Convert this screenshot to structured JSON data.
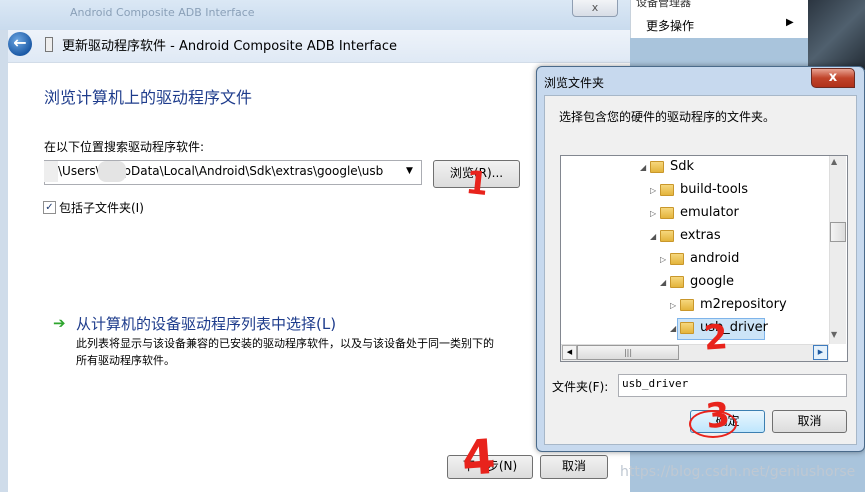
{
  "background": {
    "breadcrumb": "Android Composite ADB Interface",
    "close_label": "x",
    "right_panel_title": "设备管理器",
    "right_panel_item": "更多操作",
    "right_panel_arrow": "▶"
  },
  "wizard": {
    "title": "更新驱动程序软件 - Android Composite ADB Interface",
    "heading": "浏览计算机上的驱动程序文件",
    "search_label": "在以下位置搜索驱动程序软件:",
    "path_value": "\\Users\\      \\AppData\\Local\\Android\\Sdk\\extras\\google\\usb",
    "browse_label": "浏览(R)...",
    "include_subfolders_label": "包括子文件夹(I)",
    "include_subfolders_checked": true,
    "pick_heading": "从计算机的设备驱动程序列表中选择(L)",
    "pick_desc_1": "此列表将显示与该设备兼容的已安装的驱动程序软件，以及与该设备处于同一类别下的",
    "pick_desc_2": "所有驱动程序软件。",
    "next_label": "下一步(N)",
    "cancel_label": "取消"
  },
  "browse_dialog": {
    "title": "浏览文件夹",
    "close_label": "x",
    "prompt": "选择包含您的硬件的驱动程序的文件夹。",
    "tree": [
      {
        "label": "Sdk",
        "expanded": true
      },
      {
        "label": "build-tools",
        "expanded": false
      },
      {
        "label": "emulator",
        "expanded": false
      },
      {
        "label": "extras",
        "expanded": true
      },
      {
        "label": "android",
        "expanded": false
      },
      {
        "label": "google",
        "expanded": true
      },
      {
        "label": "m2repository",
        "expanded": false
      },
      {
        "label": "usb_driver",
        "expanded": true,
        "selected": true
      }
    ],
    "folder_label": "文件夹(F):",
    "folder_value": "usb_driver",
    "ok_label": "确定",
    "cancel_label": "取消"
  },
  "annotations": [
    "1",
    "2",
    "3",
    "4"
  ],
  "watermark": "https://blog.csdn.net/geniushorse",
  "colors": {
    "annotation": "#e8231c",
    "link_heading": "#1e3c8c",
    "selection": "#cce4f7"
  }
}
